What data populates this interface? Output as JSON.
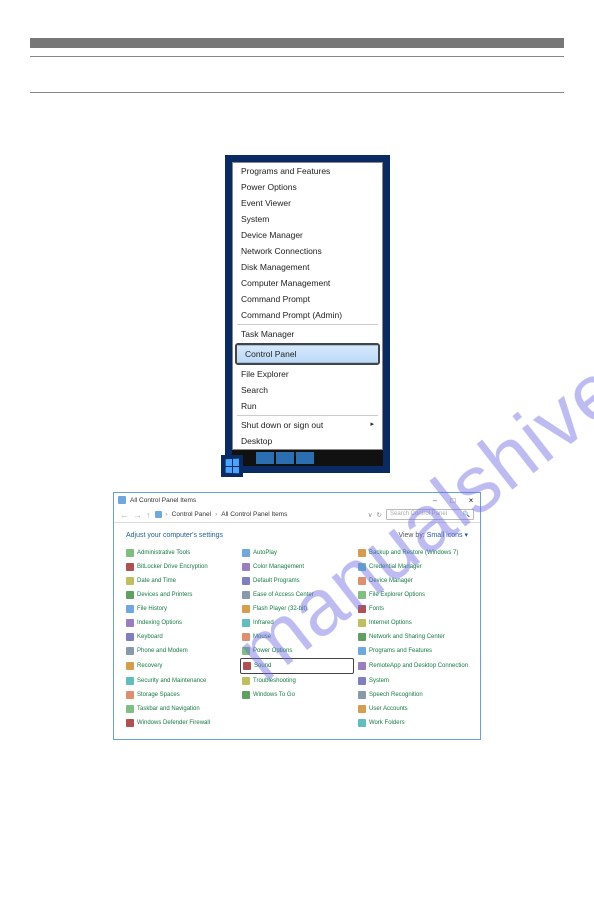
{
  "watermark": "manualshive.com",
  "winx": {
    "items_top": [
      "Programs and Features",
      "Power Options",
      "Event Viewer",
      "System",
      "Device Manager",
      "Network Connections",
      "Disk Management",
      "Computer Management",
      "Command Prompt",
      "Command Prompt (Admin)"
    ],
    "task_manager": "Task Manager",
    "control_panel": "Control Panel",
    "items_mid": [
      "File Explorer",
      "Search",
      "Run"
    ],
    "shutdown": "Shut down or sign out",
    "desktop": "Desktop"
  },
  "cp": {
    "window_title": "All Control Panel Items",
    "breadcrumb": {
      "root": "Control Panel",
      "leaf": "All Control Panel Items"
    },
    "search_placeholder": "Search Control Panel",
    "header": "Adjust your computer's settings",
    "view_label": "View by:",
    "view_value": "Small icons",
    "col1": [
      "Administrative Tools",
      "BitLocker Drive Encryption",
      "Date and Time",
      "Devices and Printers",
      "File History",
      "Indexing Options",
      "Keyboard",
      "Phone and Modem",
      "Recovery",
      "Security and Maintenance",
      "Storage Spaces",
      "Taskbar and Navigation",
      "Windows Defender Firewall"
    ],
    "col2": [
      "AutoPlay",
      "Color Management",
      "Default Programs",
      "Ease of Access Center",
      "Flash Player (32-bit)",
      "Infrared",
      "Mouse",
      "Power Options",
      "Sound",
      "Troubleshooting",
      "Windows To Go"
    ],
    "col3": [
      "Backup and Restore (Windows 7)",
      "Credential Manager",
      "Device Manager",
      "File Explorer Options",
      "Fonts",
      "Internet Options",
      "Network and Sharing Center",
      "Programs and Features",
      "RemoteApp and Desktop Connections",
      "System",
      "Speech Recognition",
      "User Accounts",
      "Work Folders"
    ],
    "highlight_index_col2": 8
  }
}
